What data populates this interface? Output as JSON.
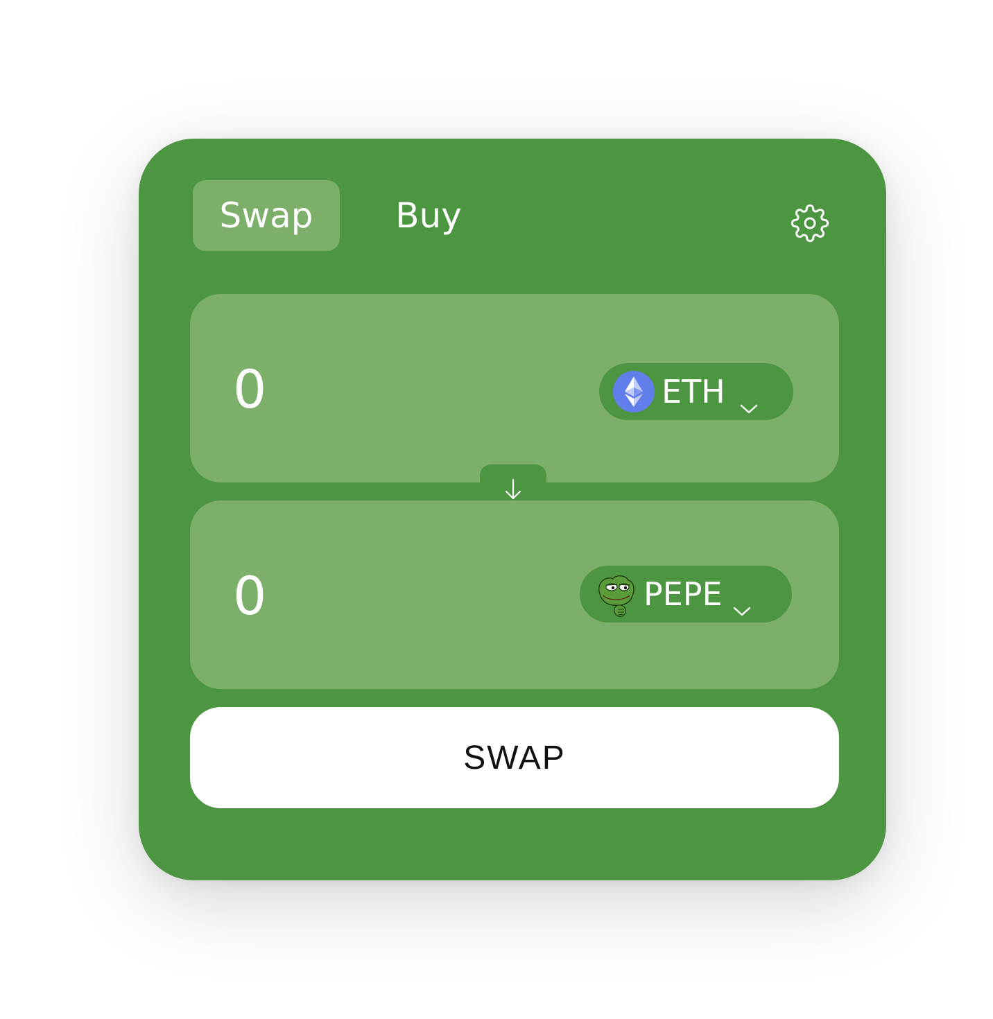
{
  "tabs": [
    {
      "label": "Swap",
      "active": true
    },
    {
      "label": "Buy",
      "active": false
    }
  ],
  "settings_icon": "gear-icon",
  "from": {
    "amount": "0",
    "token": {
      "symbol": "ETH",
      "icon": "ethereum-logo-icon"
    }
  },
  "to": {
    "amount": "0",
    "token": {
      "symbol": "PEPE",
      "icon": "pepe-logo-icon"
    }
  },
  "switch_icon": "arrow-down-icon",
  "action": {
    "label": "SWAP"
  },
  "colors": {
    "card": "#4c9641",
    "panel": "#7caf6a",
    "text": "#ffffff",
    "button_bg": "#ffffff",
    "button_text": "#111111",
    "eth": "#627eea"
  }
}
